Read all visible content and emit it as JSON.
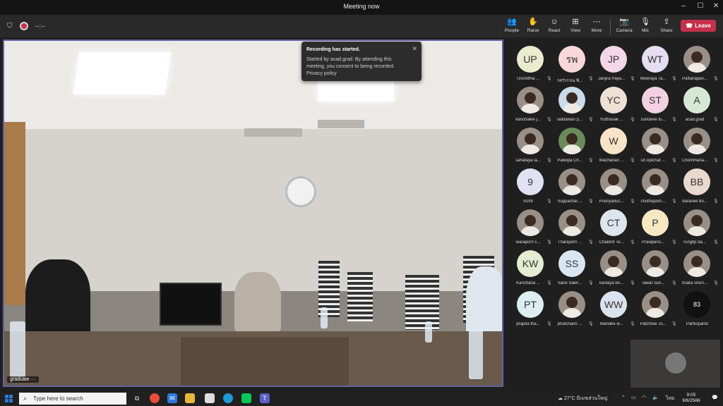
{
  "window": {
    "title": "Meeting now",
    "minimize": "–",
    "maximize": "☐",
    "close": "✕"
  },
  "toolbar": {
    "timer": "--:--",
    "buttons": [
      {
        "label": "People",
        "icon": "👥"
      },
      {
        "label": "Raise",
        "icon": "✋"
      },
      {
        "label": "React",
        "icon": "☺"
      },
      {
        "label": "View",
        "icon": "⊞"
      },
      {
        "label": "More",
        "icon": "⋯"
      },
      {
        "label": "Camera",
        "icon": "📷"
      },
      {
        "label": "Mic",
        "icon": "🎙"
      },
      {
        "label": "Share",
        "icon": "⇪"
      }
    ],
    "leave": "Leave",
    "leave_color": "#c4314b"
  },
  "video": {
    "label": "graduate",
    "more": "···"
  },
  "toast": {
    "title": "Recording has started.",
    "body": "Started by acad.grad. By attending this meeting, you consent to being recorded.",
    "link": "Privacy policy",
    "close": "✕"
  },
  "participants": [
    {
      "initials": "UP",
      "name": "Unchittha ...",
      "bg": "#e9eccf"
    },
    {
      "initials": "รพ",
      "name": "รสรัวรรณ พิ...",
      "bg": "#f8d7da"
    },
    {
      "initials": "JP",
      "name": "Janjira Paya...",
      "bg": "#f3d6e8"
    },
    {
      "initials": "WT",
      "name": "Weeraya Ta...",
      "bg": "#e4def0"
    },
    {
      "initials": "",
      "name": "Pattanapan...",
      "bg": "#9a8f86",
      "photo": true
    },
    {
      "initials": "",
      "name": "kanchalee j...",
      "bg": "#9a8f86",
      "photo": true
    },
    {
      "initials": "",
      "name": "laddawan p...",
      "bg": "#c9dbe8",
      "photo": true
    },
    {
      "initials": "YC",
      "name": "Yutthasak ...",
      "bg": "#eee0d3"
    },
    {
      "initials": "ST",
      "name": "suntaree tu...",
      "bg": "#f2d2e0"
    },
    {
      "initials": "A",
      "name": "acad.grad",
      "bg": "#d4e8d4"
    },
    {
      "initials": "",
      "name": "sahataya la...",
      "bg": "#9a8f86",
      "photo": true
    },
    {
      "initials": "",
      "name": "Palwipa Ch...",
      "bg": "#6a8a5a",
      "photo": true
    },
    {
      "initials": "W",
      "name": "Wachanan ...",
      "bg": "#f7e3c8"
    },
    {
      "initials": "",
      "name": "Dr.Apichat ...",
      "bg": "#9a8f86",
      "photo": true
    },
    {
      "initials": "",
      "name": "Chommana...",
      "bg": "#9a8f86",
      "photo": true
    },
    {
      "initials": "9",
      "name": "9199",
      "bg": "#e2e1f1"
    },
    {
      "initials": "",
      "name": "Suppachai ...",
      "bg": "#9a8f86",
      "photo": true
    },
    {
      "initials": "",
      "name": "Poonyanuc...",
      "bg": "#9a8f86",
      "photo": true
    },
    {
      "initials": "",
      "name": "chuthaporn...",
      "bg": "#9a8f86",
      "photo": true
    },
    {
      "initials": "BB",
      "name": "baranee bo...",
      "bg": "#ead9cf"
    },
    {
      "initials": "",
      "name": "waraporn c...",
      "bg": "#9a8f86",
      "photo": true
    },
    {
      "initials": "",
      "name": "Tharaporn ...",
      "bg": "#9a8f86",
      "photo": true
    },
    {
      "initials": "CT",
      "name": "Chakkrit Te...",
      "bg": "#dde6ee"
    },
    {
      "initials": "P",
      "name": "Prawpans...",
      "bg": "#f7e8c4"
    },
    {
      "initials": "",
      "name": "rungtip da...",
      "bg": "#9a8f86",
      "photo": true
    },
    {
      "initials": "KW",
      "name": "Kanchana ...",
      "bg": "#e6ecd2"
    },
    {
      "initials": "SS",
      "name": "Sane Saen...",
      "bg": "#d9e6f2"
    },
    {
      "initials": "",
      "name": "kanlaya bo...",
      "bg": "#9a8f86",
      "photo": true
    },
    {
      "initials": "",
      "name": "Tawat Suri...",
      "bg": "#9a8f86",
      "photo": true
    },
    {
      "initials": "",
      "name": "Klaita srisin...",
      "bg": "#9a8f86",
      "photo": true
    },
    {
      "initials": "PT",
      "name": "prapita tha...",
      "bg": "#dceef2"
    },
    {
      "initials": "",
      "name": "phatcharin ...",
      "bg": "#9a8f86",
      "photo": true
    },
    {
      "initials": "WW",
      "name": "Wandee w...",
      "bg": "#dbe3f0"
    },
    {
      "initials": "",
      "name": "Patchree To...",
      "bg": "#9a8f86",
      "photo": true
    }
  ],
  "overflow": {
    "count": "83",
    "label": "Participants"
  },
  "taskbar": {
    "search_placeholder": "Type here to search",
    "weather": "27°C มีเมฆส่วนใหญ่",
    "lang": "ไทย",
    "time": "9:05",
    "date": "9/6/2566"
  }
}
